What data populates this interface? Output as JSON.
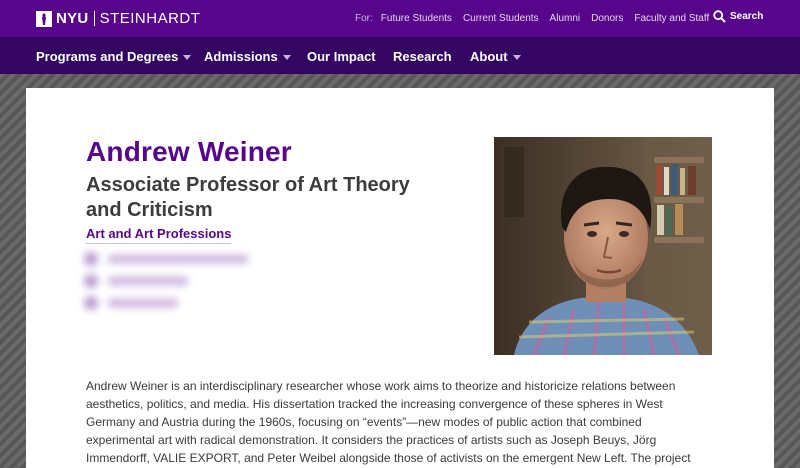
{
  "header": {
    "logo_nyu": "NYU",
    "logo_school": "STEINHARDT",
    "audience_prefix": "For:",
    "audience_links": [
      "Future Students",
      "Current Students",
      "Alumni",
      "Donors",
      "Faculty and Staff"
    ],
    "search_label": "Search"
  },
  "nav": {
    "items": [
      {
        "label": "Programs and Degrees",
        "has_dropdown": true
      },
      {
        "label": "Admissions",
        "has_dropdown": true
      },
      {
        "label": "Our Impact",
        "has_dropdown": false
      },
      {
        "label": "Research",
        "has_dropdown": false
      },
      {
        "label": "About",
        "has_dropdown": true
      }
    ]
  },
  "profile": {
    "name": "Andrew Weiner",
    "title": "Associate Professor of Art Theory and Criticism",
    "department": "Art and Art Professions",
    "bio": "Andrew Weiner is an interdisciplinary researcher whose work aims to theorize and historicize relations between aesthetics, politics, and media. His dissertation tracked the increasing convergence of these spheres in West Germany and Austria during the 1960s, focusing on “events”—new modes of public action that combined experimental art with radical demonstration. It considers the practices of artists such as Joseph Beuys, Jörg Immendorff, VALIE EXPORT, and Peter Weibel alongside those of activists on the emergent New Left. The project"
  },
  "colors": {
    "brand_purple": "#57068c",
    "nav_dark": "#330662"
  }
}
